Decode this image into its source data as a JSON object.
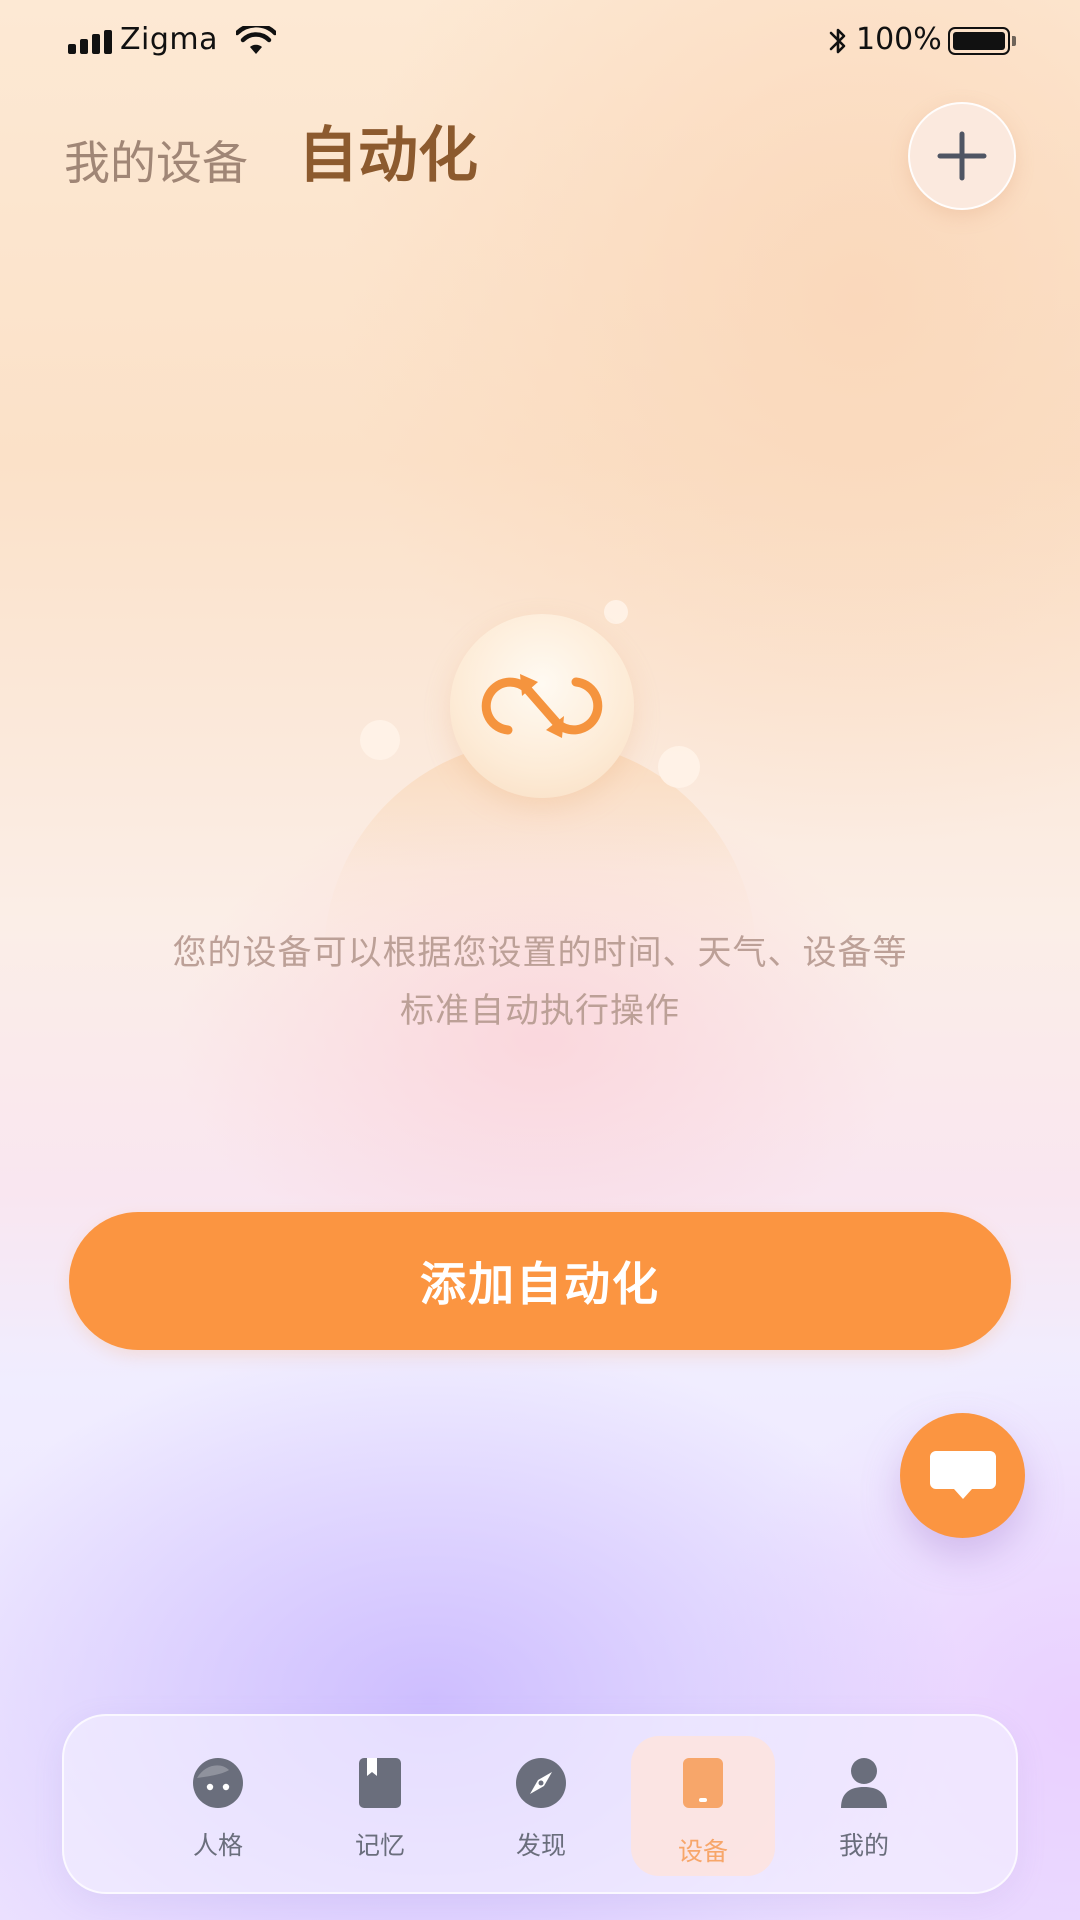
{
  "status_bar": {
    "carrier": "Zigma",
    "battery_percent": "100%",
    "battery_level": 1.0,
    "signal_bars": 4,
    "icons": [
      "signal-icon",
      "wifi-icon",
      "bluetooth-icon",
      "battery-icon"
    ]
  },
  "header": {
    "tab_devices": "我的设备",
    "tab_automation": "自动化",
    "active_tab": "自动化",
    "add_icon": "plus-icon"
  },
  "empty_state": {
    "icon": "automation-loop-icon",
    "description_line1": "您的设备可以根据您设置的时间、天气、设备等",
    "description_line2": "标准自动执行操作"
  },
  "primary_action": {
    "label": "添加自动化"
  },
  "chat_fab": {
    "icon": "chat-bubble-icon"
  },
  "bottom_nav": {
    "items": [
      {
        "label": "人格",
        "icon": "persona-face-icon",
        "active": false
      },
      {
        "label": "记忆",
        "icon": "memory-book-icon",
        "active": false
      },
      {
        "label": "发现",
        "icon": "compass-icon",
        "active": false
      },
      {
        "label": "设备",
        "icon": "device-phone-icon",
        "active": true
      },
      {
        "label": "我的",
        "icon": "profile-person-icon",
        "active": false
      }
    ]
  },
  "colors": {
    "accent": "#fb9541",
    "active_tab_text": "#8c5a2e",
    "inactive_tab_text": "#a08676",
    "description_text": "#bca097",
    "nav_icon": "#6a6e7c",
    "nav_active": "#f7a66a"
  }
}
